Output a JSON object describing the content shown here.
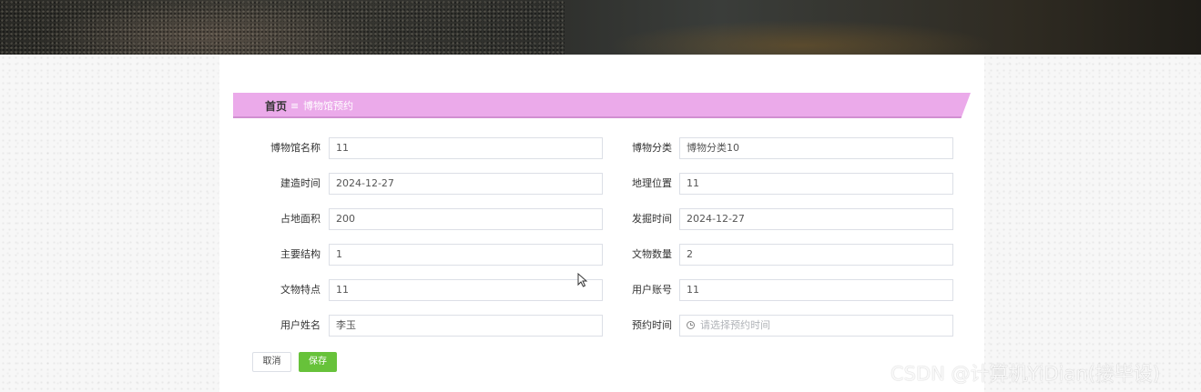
{
  "breadcrumb": {
    "home": "首页",
    "separator": "≡",
    "current": "博物馆预约"
  },
  "form": {
    "left": [
      {
        "label": "博物馆名称",
        "value": "11"
      },
      {
        "label": "建造时间",
        "value": "2024-12-27"
      },
      {
        "label": "占地面积",
        "value": "200"
      },
      {
        "label": "主要结构",
        "value": "1"
      },
      {
        "label": "文物特点",
        "value": "11"
      },
      {
        "label": "用户姓名",
        "value": "李玉"
      }
    ],
    "right": [
      {
        "label": "博物分类",
        "value": "博物分类10"
      },
      {
        "label": "地理位置",
        "value": "11"
      },
      {
        "label": "发掘时间",
        "value": "2024-12-27"
      },
      {
        "label": "文物数量",
        "value": "2"
      },
      {
        "label": "用户账号",
        "value": "11"
      },
      {
        "label": "预约时间",
        "placeholder": "请选择预约时间"
      }
    ]
  },
  "buttons": {
    "cancel": "取消",
    "save": "保存"
  },
  "watermark": "CSDN @计算机YiDian(接毕设)",
  "colors": {
    "breadcrumb_bg": "#ebaaea",
    "save_button": "#67c23a",
    "input_border": "#dcdfe6"
  }
}
